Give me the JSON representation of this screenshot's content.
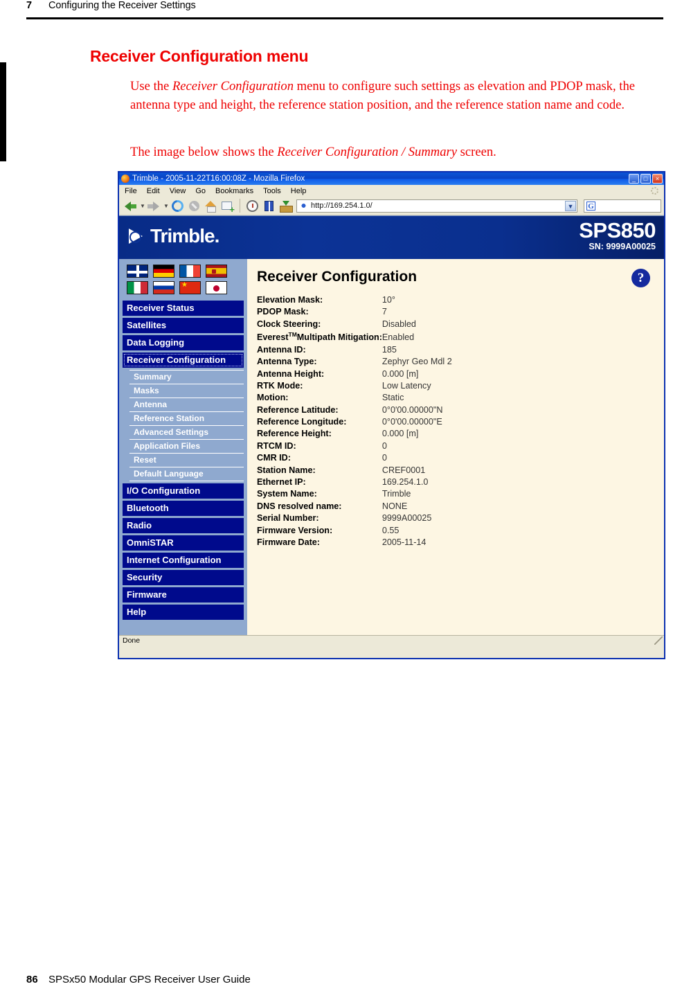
{
  "page": {
    "chapter_number": "7",
    "chapter_title": "Configuring the Receiver Settings",
    "footer_page_number": "86",
    "footer_title": "SPSx50 Modular GPS Receiver User Guide"
  },
  "section": {
    "heading": "Receiver Configuration menu",
    "paragraph1_a": "Use the ",
    "paragraph1_em": "Receiver Configuration",
    "paragraph1_b": " menu to configure such settings as elevation and PDOP mask, the antenna type and height, the reference station position, and the reference station name and code.",
    "paragraph2_a": "The image below shows the ",
    "paragraph2_em": "Receiver Configuration / Summary",
    "paragraph2_b": " screen."
  },
  "browser": {
    "title": "Trimble - 2005-11-22T16:00:08Z - Mozilla Firefox",
    "window_buttons": {
      "minimize": "_",
      "maximize": "□",
      "close": "×"
    },
    "menu": [
      "File",
      "Edit",
      "View",
      "Go",
      "Bookmarks",
      "Tools",
      "Help"
    ],
    "toolbar_icons": [
      "back-icon",
      "forward-icon",
      "reload-icon",
      "stop-icon",
      "home-icon",
      "new-tab-icon",
      "history-icon",
      "bookmarks-icon",
      "downloads-icon"
    ],
    "url": "http://169.254.1.0/",
    "search_engine_label": "G",
    "status": "Done"
  },
  "banner": {
    "brand": "Trimble.",
    "model": "SPS850",
    "serial_label": "SN: 9999A00025"
  },
  "sidebar": {
    "flags": [
      {
        "name": "flag-uk",
        "label": "United Kingdom"
      },
      {
        "name": "flag-de",
        "label": "Germany"
      },
      {
        "name": "flag-fr",
        "label": "France"
      },
      {
        "name": "flag-es",
        "label": "Spain"
      },
      {
        "name": "flag-it",
        "label": "Italy"
      },
      {
        "name": "flag-ru",
        "label": "Russia"
      },
      {
        "name": "flag-cn",
        "label": "China"
      },
      {
        "name": "flag-jp",
        "label": "Japan"
      }
    ],
    "items": [
      {
        "label": "Receiver Status",
        "active": false
      },
      {
        "label": "Satellites",
        "active": false
      },
      {
        "label": "Data Logging",
        "active": false
      },
      {
        "label": "Receiver Configuration",
        "active": true
      }
    ],
    "subitems": [
      {
        "label": "Summary"
      },
      {
        "label": "Masks"
      },
      {
        "label": "Antenna"
      },
      {
        "label": "Reference Station"
      },
      {
        "label": "Advanced Settings"
      },
      {
        "label": "Application Files"
      },
      {
        "label": "Reset"
      },
      {
        "label": "Default Language"
      }
    ],
    "items_lower": [
      {
        "label": "I/O Configuration"
      },
      {
        "label": "Bluetooth"
      },
      {
        "label": "Radio"
      },
      {
        "label": "OmniSTAR"
      },
      {
        "label": "Internet Configuration"
      },
      {
        "label": "Security"
      },
      {
        "label": "Firmware"
      },
      {
        "label": "Help"
      }
    ]
  },
  "content": {
    "title": "Receiver Configuration",
    "help_glyph": "?",
    "rows": [
      {
        "label": "Elevation Mask:",
        "value": "10°"
      },
      {
        "label": "PDOP Mask:",
        "value": "7"
      },
      {
        "label": "Clock Steering:",
        "value": "Disabled"
      },
      {
        "label": "Everest™Multipath Mitigation:",
        "value": "Enabled",
        "label_main": "Everest",
        "label_tm": "TM",
        "label_rest": "Multipath Mitigation:"
      },
      {
        "label": "Antenna ID:",
        "value": "185"
      },
      {
        "label": "Antenna Type:",
        "value": "Zephyr Geo Mdl 2"
      },
      {
        "label": "Antenna Height:",
        "value": "0.000 [m]"
      },
      {
        "label": "RTK Mode:",
        "value": "Low Latency"
      },
      {
        "label": "Motion:",
        "value": "Static"
      },
      {
        "label": "Reference Latitude:",
        "value": "0°0'00.00000\"N"
      },
      {
        "label": "Reference Longitude:",
        "value": "0°0'00.00000\"E"
      },
      {
        "label": "Reference Height:",
        "value": "0.000 [m]"
      },
      {
        "label": "RTCM ID:",
        "value": "0"
      },
      {
        "label": "CMR ID:",
        "value": "0"
      },
      {
        "label": "Station Name:",
        "value": "CREF0001"
      },
      {
        "label": "Ethernet IP:",
        "value": "169.254.1.0"
      },
      {
        "label": "System Name:",
        "value": "Trimble"
      },
      {
        "label": "DNS resolved name:",
        "value": "NONE"
      },
      {
        "label": "Serial Number:",
        "value": "9999A00025"
      },
      {
        "label": "Firmware Version:",
        "value": "0.55"
      },
      {
        "label": "Firmware Date:",
        "value": "2005-11-14"
      }
    ]
  },
  "colors": {
    "accent_red": "#ee0000",
    "nav_blue": "#000a8c",
    "sidebar_blue": "#8fa9cf",
    "banner_blue": "#0c3396",
    "content_bg": "#fdf6e3"
  }
}
